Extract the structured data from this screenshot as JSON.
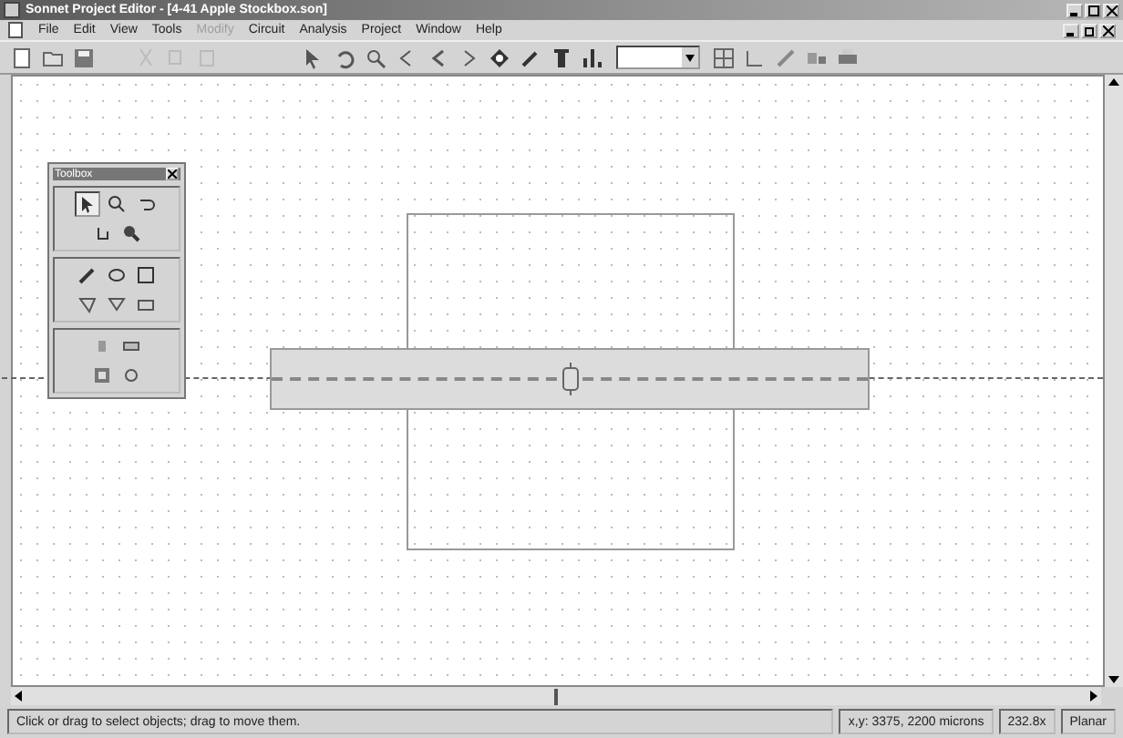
{
  "window": {
    "title": "Sonnet Project Editor - [4-41 Apple Stockbox.son]"
  },
  "menu": [
    {
      "label": "File",
      "disabled": false
    },
    {
      "label": "Edit",
      "disabled": false
    },
    {
      "label": "View",
      "disabled": false
    },
    {
      "label": "Tools",
      "disabled": false
    },
    {
      "label": "Modify",
      "disabled": true
    },
    {
      "label": "Circuit",
      "disabled": false
    },
    {
      "label": "Analysis",
      "disabled": false
    },
    {
      "label": "Project",
      "disabled": false
    },
    {
      "label": "Window",
      "disabled": false
    },
    {
      "label": "Help",
      "disabled": false
    }
  ],
  "toolbox": {
    "title": "Toolbox"
  },
  "status_bar": {
    "message": "Click or drag to select objects; drag to move them.",
    "coords": "x,y: 3375, 2200 microns",
    "zoom": "232.8x",
    "mode": "Planar"
  }
}
